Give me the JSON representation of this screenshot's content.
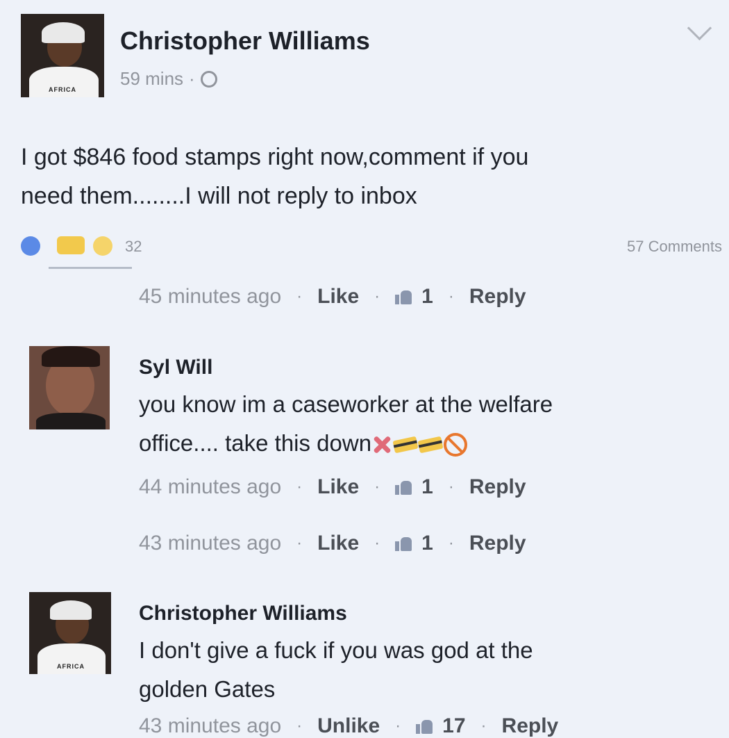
{
  "post": {
    "author": "Christopher Williams",
    "time": "59 mins",
    "separator": "·",
    "text_line1": "I got $846 food stamps right now,comment if you",
    "text_line2": "need them........I will not reply to inbox",
    "reaction_count": "32",
    "comments_count": "57 Comments",
    "avatar_text": "AFRICA",
    "icons": [
      "globe-icon",
      "chevron-down-icon",
      "like-reaction-icon",
      "haha-reaction-icon",
      "wow-reaction-icon"
    ]
  },
  "actions": {
    "dot": "·",
    "like": "Like",
    "unlike": "Unlike",
    "reply": "Reply"
  },
  "comments": [
    {
      "time": "45 minutes ago",
      "likes": "1"
    },
    {
      "name": "Syl Will",
      "text_line1": "you know im a caseworker at the welfare",
      "text_line2": "office.... take this down",
      "emojis": [
        "cross-mark-icon",
        "credit-card-icon",
        "credit-card-icon",
        "no-entry-icon"
      ],
      "time": "44 minutes ago",
      "likes": "1"
    },
    {
      "time": "43 minutes ago",
      "likes": "1"
    },
    {
      "name": "Christopher Williams",
      "text_line1": "I don't give a fuck if you was god at the",
      "text_line2": "golden Gates",
      "time": "43 minutes ago",
      "likes": "17"
    }
  ],
  "colors": {
    "background": "#eef2f9",
    "text": "#1d2129",
    "meta": "#90949c",
    "link": "#4b4f56"
  }
}
